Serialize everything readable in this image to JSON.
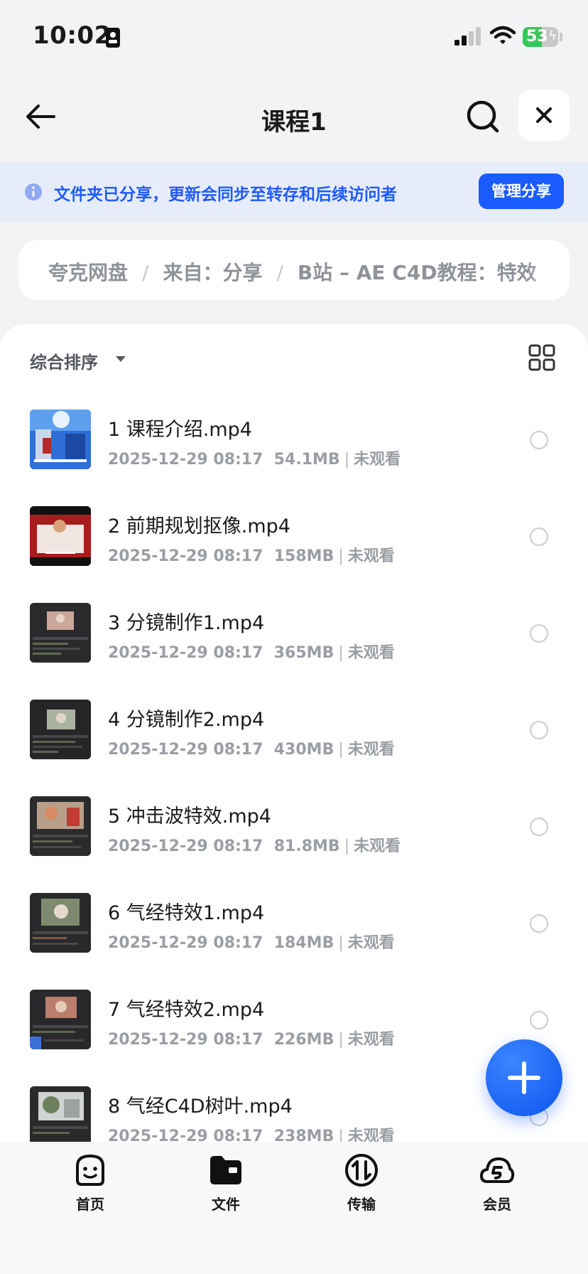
{
  "status_bar": {
    "time": "10:02",
    "battery": "53",
    "battery_level_percent": 53
  },
  "nav": {
    "title": "课程1"
  },
  "share_banner": {
    "text": "文件夹已分享，更新会同步至转存和后续访问者",
    "button": "管理分享"
  },
  "breadcrumb": {
    "items": [
      "夸克网盘",
      "来自：分享",
      "B站 – AE C4D教程：特效"
    ]
  },
  "sort": {
    "label": "综合排序"
  },
  "files": [
    {
      "name": "1 课程介绍.mp4",
      "date": "2025-12-29 08:17",
      "size": "54.1MB",
      "status": "未观看"
    },
    {
      "name": "2 前期规划抠像.mp4",
      "date": "2025-12-29 08:17",
      "size": "158MB",
      "status": "未观看"
    },
    {
      "name": "3 分镜制作1.mp4",
      "date": "2025-12-29 08:17",
      "size": "365MB",
      "status": "未观看"
    },
    {
      "name": "4 分镜制作2.mp4",
      "date": "2025-12-29 08:17",
      "size": "430MB",
      "status": "未观看"
    },
    {
      "name": "5 冲击波特效.mp4",
      "date": "2025-12-29 08:17",
      "size": "81.8MB",
      "status": "未观看"
    },
    {
      "name": "6 气经特效1.mp4",
      "date": "2025-12-29 08:17",
      "size": "184MB",
      "status": "未观看"
    },
    {
      "name": "7 气经特效2.mp4",
      "date": "2025-12-29 08:17",
      "size": "226MB",
      "status": "未观看"
    },
    {
      "name": "8 气经C4D树叶.mp4",
      "date": "2025-12-29 08:17",
      "size": "238MB",
      "status": "未观看"
    }
  ],
  "tabbar": {
    "items": [
      {
        "label": "首页",
        "icon": "smile-face-icon"
      },
      {
        "label": "文件",
        "icon": "folder-icon"
      },
      {
        "label": "传输",
        "icon": "transfer-icon"
      },
      {
        "label": "会员",
        "icon": "cloud-member-icon"
      }
    ]
  },
  "colors": {
    "accent": "#1a5cff",
    "banner_bg": "#e7ecfb",
    "page_bg": "#f2f3f5"
  }
}
